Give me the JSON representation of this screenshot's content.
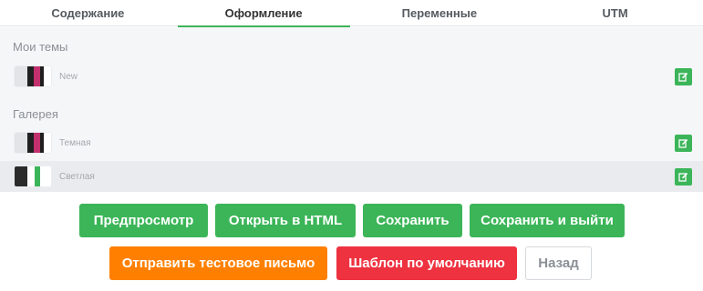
{
  "tabs": [
    "Содержание",
    "Оформление",
    "Переменные",
    "UTM"
  ],
  "sections": {
    "my_themes": {
      "title": "Мои темы",
      "items": [
        {
          "name": "New",
          "colors": [
            "#e3e4e7",
            "#1f1f1f",
            "#c2306e",
            "#1f1f1f"
          ]
        }
      ]
    },
    "gallery": {
      "title": "Галерея",
      "items": [
        {
          "name": "Темная",
          "colors": [
            "#e3e4e7",
            "#1f1f1f",
            "#c2306e",
            "#1f1f1f"
          ]
        },
        {
          "name": "Светлая",
          "colors": [
            "#ffffff",
            "#2b2b2b",
            "#ffffff",
            "#3cb55a"
          ]
        }
      ]
    }
  },
  "buttons": {
    "preview": "Предпросмотр",
    "open_html": "Открыть в HTML",
    "save": "Сохранить",
    "save_exit": "Сохранить и выйти",
    "send_test": "Отправить тестовое письмо",
    "default_template": "Шаблон по умолчанию",
    "back": "Назад"
  },
  "colors": {
    "accent_green": "#3bb558",
    "orange": "#ff8000",
    "red": "#ee3240"
  },
  "icons": {
    "edit": "pencil-edit-icon"
  }
}
